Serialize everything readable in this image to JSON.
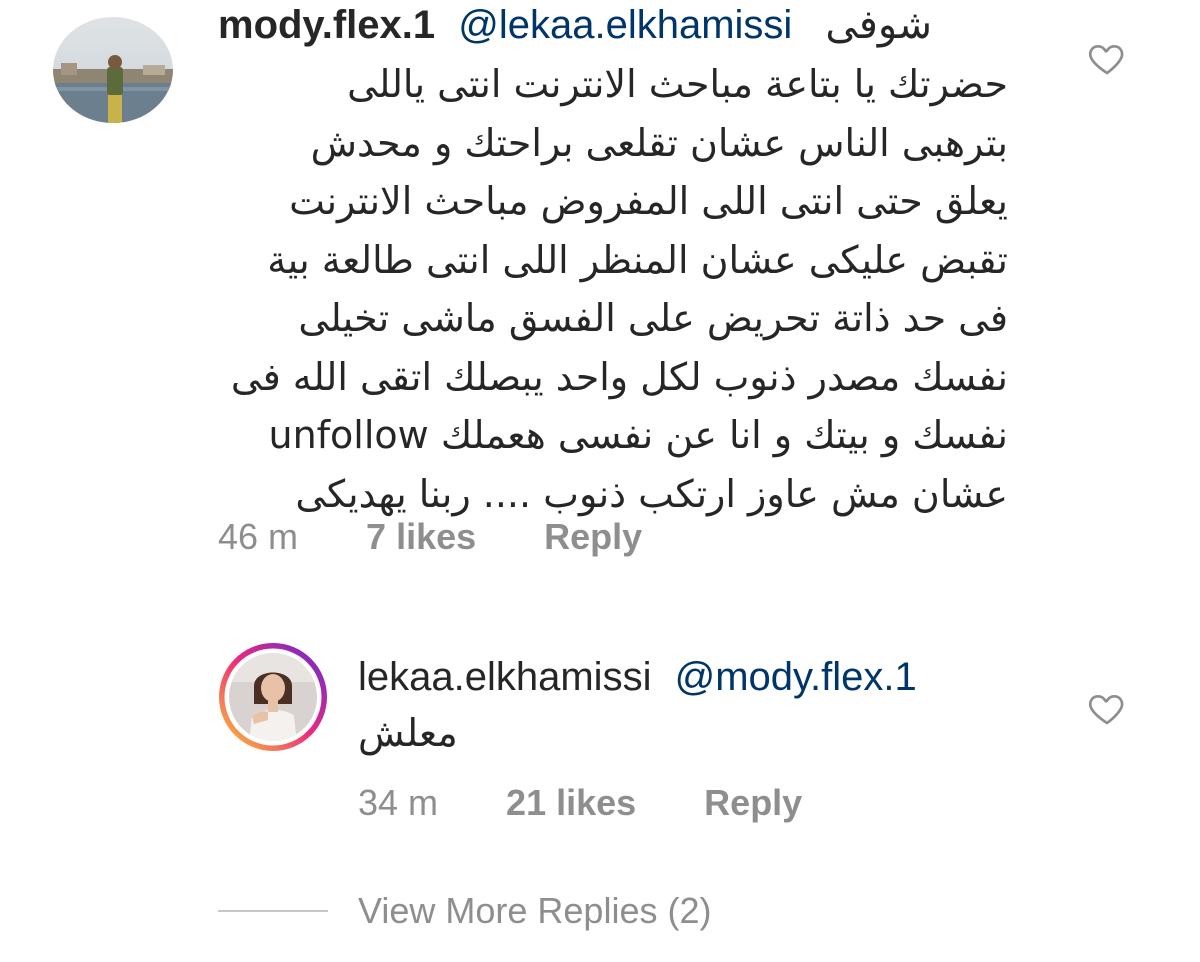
{
  "comments": [
    {
      "username": "mody.flex.1",
      "mention": "@lekaa.elkhamissi",
      "first_line_text": "شوفى",
      "body_lines": [
        "حضرتك يا بتاعة مباحث الانترنت انتى ياللى",
        "بترهبى الناس عشان تقلعى براحتك و محدش",
        "يعلق حتى انتى اللى المفروض مباحث الانترنت",
        "تقبض عليكى عشان المنظر اللى انتى طالعة بية",
        "فى حد ذاتة تحريض على الفسق ماشى تخيلى",
        "نفسك مصدر ذنوب لكل واحد يبصلك اتقى الله فى",
        "نفسك و بيتك و انا عن نفسى هعملك unfollow",
        "عشان مش عاوز ارتكب ذنوب .... ربنا يهديكى"
      ],
      "time": "46 m",
      "likes": "7 likes",
      "reply_label": "Reply",
      "like_icon": "heart-outline-icon"
    },
    {
      "username": "lekaa.elkhamissi",
      "mention": "@mody.flex.1",
      "body_lines": [
        "معلش"
      ],
      "time": "34 m",
      "likes": "21 likes",
      "reply_label": "Reply",
      "like_icon": "heart-outline-icon",
      "has_story_ring": true
    }
  ],
  "view_more": {
    "label": "View More Replies (2)"
  },
  "colors": {
    "text": "#262626",
    "mention": "#003569",
    "secondary": "#8e8e8e",
    "story_ring_start": "#f9ce34",
    "story_ring_mid": "#ee2a7b",
    "story_ring_end": "#6228d7"
  }
}
